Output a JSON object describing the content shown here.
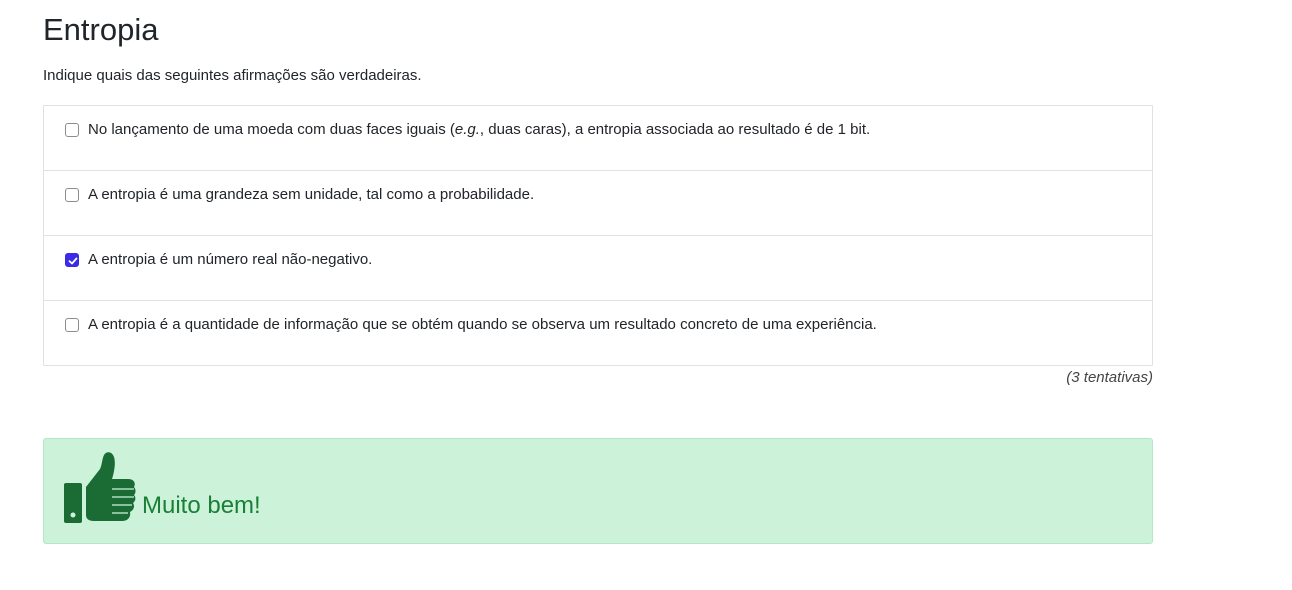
{
  "question": {
    "title": "Entropia",
    "prompt": "Indique quais das seguintes afirmações são verdadeiras.",
    "options": [
      {
        "text_before": "No lançamento de uma moeda com duas faces iguais (",
        "text_italic": "e.g.",
        "text_after": ", duas caras), a entropia associada ao resultado é de 1 bit.",
        "checked": false
      },
      {
        "text": "A entropia é uma grandeza sem unidade, tal como a probabilidade.",
        "checked": false
      },
      {
        "text": "A entropia é um número real não-negativo.",
        "checked": true
      },
      {
        "text": "A entropia é a quantidade de informação que se obtém quando se observa um resultado concreto de uma experiência.",
        "checked": false
      }
    ],
    "attempts": "(3 tentativas)"
  },
  "feedback": {
    "icon": "thumbs-up-icon",
    "message": "Muito bem!",
    "color": "#1a7f37",
    "background": "#cdf2da"
  },
  "colors": {
    "checkbox_checked": "#3b2be6",
    "border": "#dee2e6"
  }
}
